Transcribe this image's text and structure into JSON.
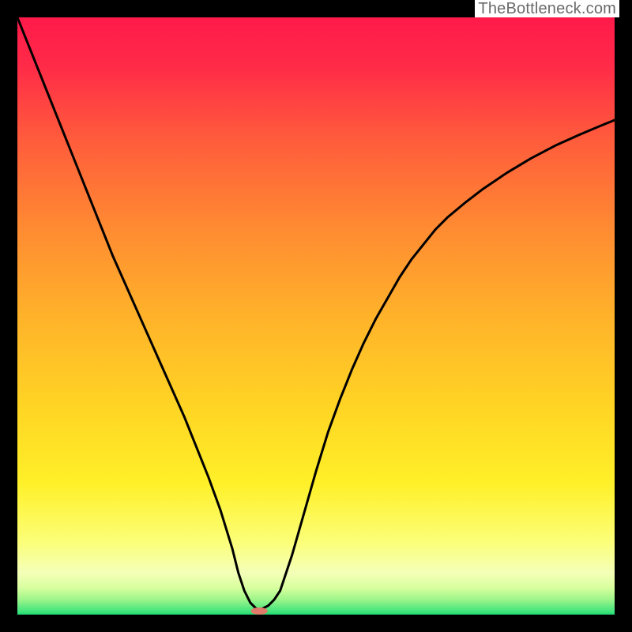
{
  "attribution": "TheBottleneck.com",
  "chart_data": {
    "type": "line",
    "title": "",
    "xlabel": "",
    "ylabel": "",
    "xlim": [
      0,
      100
    ],
    "ylim": [
      0,
      100
    ],
    "x": [
      0,
      2,
      4,
      6,
      8,
      10,
      12,
      14,
      16,
      18,
      20,
      22,
      24,
      26,
      28,
      30,
      32,
      34,
      36,
      37,
      38,
      39,
      40,
      41,
      42,
      43,
      44,
      46,
      48,
      50,
      52,
      54,
      56,
      58,
      60,
      62,
      64,
      66,
      68,
      70,
      72,
      75,
      78,
      82,
      86,
      90,
      94,
      98,
      100
    ],
    "values": [
      100,
      95,
      90,
      85,
      80,
      75,
      70,
      65,
      60,
      55.5,
      51,
      46.5,
      42,
      37.5,
      33,
      28,
      23,
      17.5,
      11,
      7,
      4,
      2,
      1,
      1,
      1.5,
      2.5,
      4,
      10,
      17,
      24,
      30.5,
      36,
      41,
      45.5,
      49.5,
      53,
      56.5,
      59.5,
      62,
      64.5,
      66.5,
      69,
      71.3,
      74,
      76.4,
      78.5,
      80.3,
      82,
      82.8
    ],
    "background_gradient_stops": [
      {
        "pos": 0.0,
        "color": "#ff1a4a"
      },
      {
        "pos": 0.08,
        "color": "#ff2a48"
      },
      {
        "pos": 0.2,
        "color": "#ff5a3c"
      },
      {
        "pos": 0.35,
        "color": "#ff8a32"
      },
      {
        "pos": 0.5,
        "color": "#ffb22a"
      },
      {
        "pos": 0.65,
        "color": "#ffd424"
      },
      {
        "pos": 0.78,
        "color": "#fff028"
      },
      {
        "pos": 0.88,
        "color": "#fbff7a"
      },
      {
        "pos": 0.93,
        "color": "#f4ffb8"
      },
      {
        "pos": 0.955,
        "color": "#d8ff9e"
      },
      {
        "pos": 0.975,
        "color": "#9cf58a"
      },
      {
        "pos": 0.995,
        "color": "#3fe47c"
      },
      {
        "pos": 1.0,
        "color": "#1ed870"
      }
    ],
    "marker": {
      "x": 40.5,
      "y": 0.6,
      "rx": 1.4,
      "ry": 0.6,
      "color": "#e07a6a"
    }
  }
}
